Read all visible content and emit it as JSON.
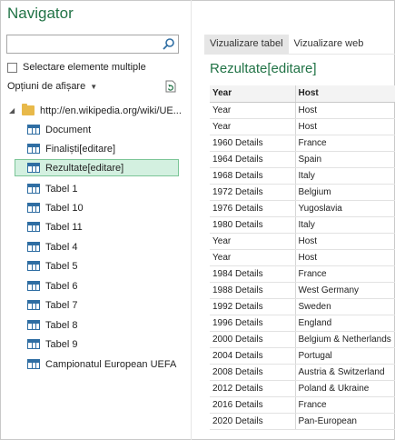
{
  "window": {
    "title": "Navigator"
  },
  "left": {
    "search_value": "",
    "multi_select_label": "Selectare elemente multiple",
    "display_options_label": "Opțiuni de afișare",
    "tree": {
      "root_label": "http://en.wikipedia.org/wiki/UE...",
      "items": [
        {
          "label": "Document"
        },
        {
          "label": "Finaliști[editare]"
        },
        {
          "label": "Rezultate[editare]",
          "selected": true
        },
        {
          "label": "Tabel 1"
        },
        {
          "label": "Tabel 10"
        },
        {
          "label": "Tabel 11"
        },
        {
          "label": "Tabel 4"
        },
        {
          "label": "Tabel 5"
        },
        {
          "label": "Tabel 6"
        },
        {
          "label": "Tabel 7"
        },
        {
          "label": "Tabel 8"
        },
        {
          "label": "Tabel 9"
        },
        {
          "label": "Campionatul European UEFA"
        }
      ]
    }
  },
  "right": {
    "tabs": [
      {
        "label": "Vizualizare tabel",
        "active": true
      },
      {
        "label": "Vizualizare web",
        "active": false
      }
    ],
    "result_title": "Rezultate[editare]",
    "table": {
      "columns": [
        "Year",
        "Host"
      ],
      "rows": [
        [
          "Year",
          "Host"
        ],
        [
          "Year",
          "Host"
        ],
        [
          "1960 Details",
          "France"
        ],
        [
          "1964 Details",
          "Spain"
        ],
        [
          "1968 Details",
          "Italy"
        ],
        [
          "1972 Details",
          "Belgium"
        ],
        [
          "1976 Details",
          "Yugoslavia"
        ],
        [
          "1980 Details",
          "Italy"
        ],
        [
          "Year",
          "Host"
        ],
        [
          "Year",
          "Host"
        ],
        [
          "1984 Details",
          "France"
        ],
        [
          "1988 Details",
          "West Germany"
        ],
        [
          "1992 Details",
          "Sweden"
        ],
        [
          "1996 Details",
          "England"
        ],
        [
          "2000 Details",
          "Belgium & Netherlands"
        ],
        [
          "2004 Details",
          "Portugal"
        ],
        [
          "2008 Details",
          "Austria & Switzerland"
        ],
        [
          "2012 Details",
          "Poland & Ukraine"
        ],
        [
          "2016 Details",
          "France"
        ],
        [
          "2020 Details",
          "Pan-European"
        ]
      ]
    }
  },
  "colors": {
    "accent": "#217346",
    "selection_bg": "#d3f0e0",
    "table_icon": "#2f6ea3",
    "folder": "#e8b94a"
  }
}
